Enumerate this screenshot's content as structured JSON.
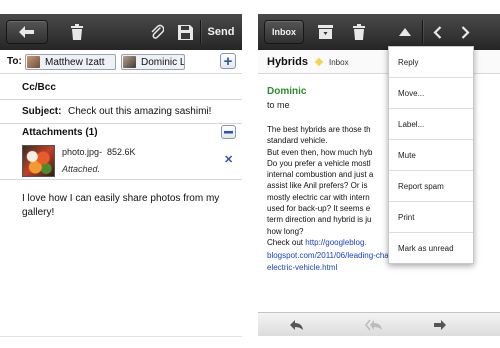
{
  "compose": {
    "toolbar": {
      "send_label": "Send"
    },
    "to_label": "To:",
    "recipients": [
      "Matthew Izatt",
      "Dominic L"
    ],
    "ccbcc_label": "Cc/Bcc",
    "subject_label": "Subject:",
    "subject_value": "Check out this amazing sashimi!",
    "attachments_header": "Attachments (1)",
    "attachment": {
      "filename": "photo.jpg",
      "size": "852.6K",
      "status": "Attached."
    },
    "body": "I love how I can easily share photos from my gallery!"
  },
  "reader": {
    "toolbar": {
      "inbox_label": "Inbox"
    },
    "subject": "Hybrids",
    "label": "Inbox",
    "sender": "Dominic",
    "to_line": "to me",
    "body_lines": [
      "The best hybrids are those th",
      "standard vehicle.",
      "But even then, how much hyb",
      "Do you prefer a vehicle mostl",
      "internal combustion and just a",
      "assist like Anil prefers? Or is",
      "mostly electric car with intern",
      "used for back-up? It seems e",
      "term direction and hybrid is ju",
      "how long?"
    ],
    "checkout_prefix": "Check out ",
    "link_parts": [
      "http://googleblog.",
      "blogspot.com/2011/06/leading-charge-toward-",
      "electric-vehicle.html"
    ],
    "menu": [
      "Reply",
      "Move...",
      "Label...",
      "Mute",
      "Report spam",
      "Print",
      "Mark as unread"
    ]
  },
  "colors": {
    "toolbar": "#2f2f2f",
    "sender_green": "#2e8b2e",
    "link_blue": "#1a44c0",
    "accent_blue": "#2c56a8",
    "label_yellow": "#f6d44a"
  }
}
